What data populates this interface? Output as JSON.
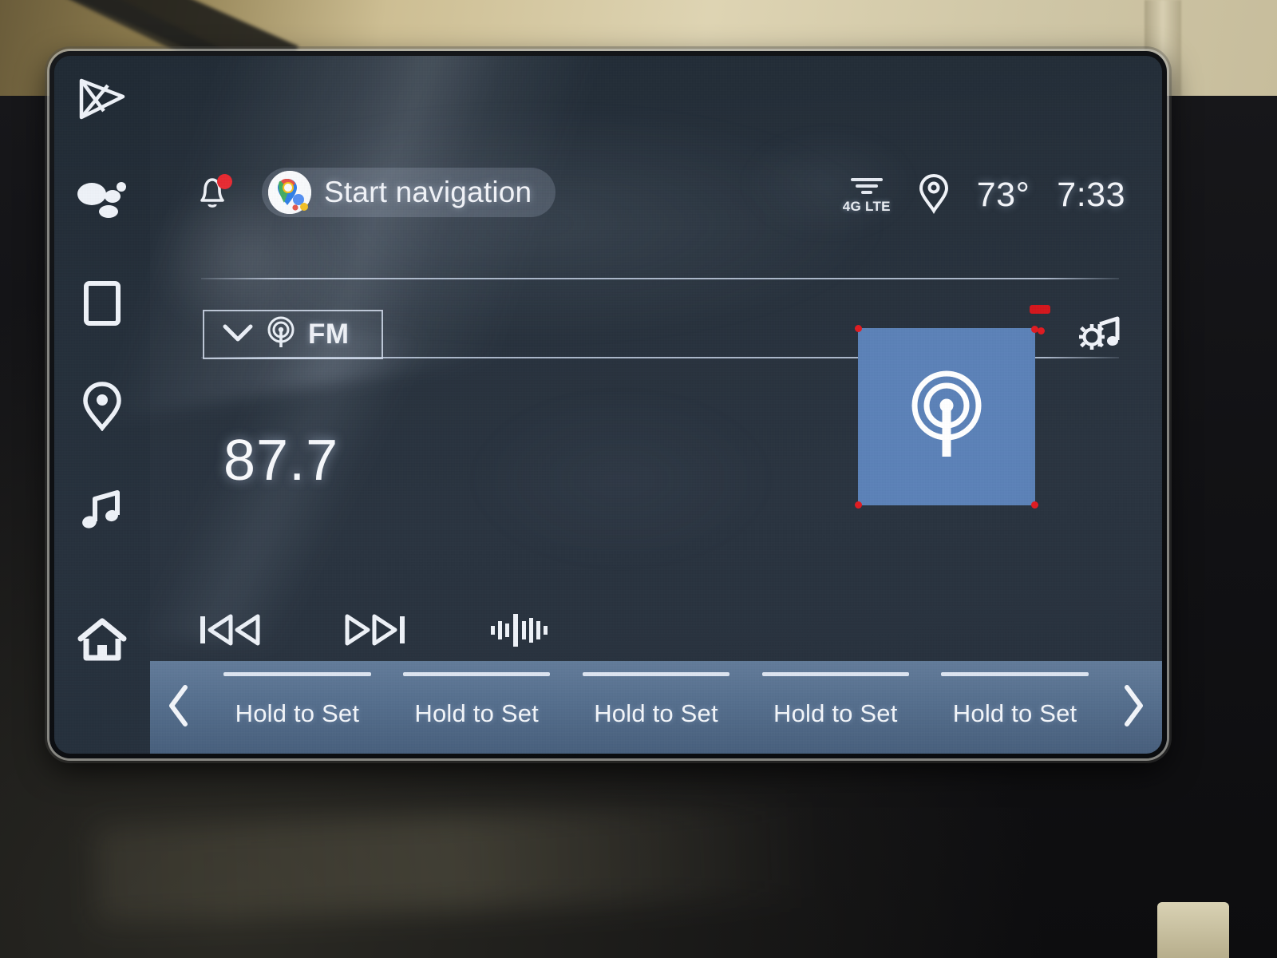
{
  "status_bar": {
    "notification_icon": "bell-icon",
    "notification_badge": true,
    "assistant_icon": "google-maps-icon",
    "assistant_label": "Start navigation",
    "network_icon": "4g-lte-signal-icon",
    "network_label": "4G LTE",
    "location_icon": "location-pin-icon",
    "temperature": "73°",
    "clock": "7:33"
  },
  "sidebar": {
    "items": [
      {
        "icon": "apps-play-icon",
        "label": "Apps"
      },
      {
        "icon": "google-assistant-icon",
        "label": "Assistant"
      },
      {
        "icon": "phone-device-icon",
        "label": "Phone"
      },
      {
        "icon": "location-pin-icon",
        "label": "Navigation"
      },
      {
        "icon": "music-note-icon",
        "label": "Media"
      },
      {
        "icon": "home-icon",
        "label": "Home"
      }
    ]
  },
  "media": {
    "source_selector": {
      "chevron_icon": "chevron-down-icon",
      "source_icon": "radio-broadcast-icon",
      "label": "FM"
    },
    "audio_settings_icon": "audio-settings-gear-note-icon",
    "frequency": "87.7",
    "station_art": {
      "icon": "radio-broadcast-icon",
      "color": "#5c82b8"
    },
    "transport": [
      {
        "icon": "seek-previous-icon",
        "label": "Seek Down"
      },
      {
        "icon": "seek-next-icon",
        "label": "Seek Up"
      },
      {
        "icon": "tune-scan-icon",
        "label": "Tune"
      }
    ]
  },
  "presets": {
    "prev_icon": "chevron-left-icon",
    "next_icon": "chevron-right-icon",
    "items": [
      {
        "label": "Hold to Set"
      },
      {
        "label": "Hold to Set"
      },
      {
        "label": "Hold to Set"
      },
      {
        "label": "Hold to Set"
      },
      {
        "label": "Hold to Set"
      }
    ]
  },
  "colors": {
    "screen_background": "#2a3440",
    "preset_bar": "#5a7391",
    "station_art": "#5c82b8",
    "accent_text": "#f4f6fa",
    "notification_red": "#e8222a",
    "marker_red": "#d4171d"
  }
}
